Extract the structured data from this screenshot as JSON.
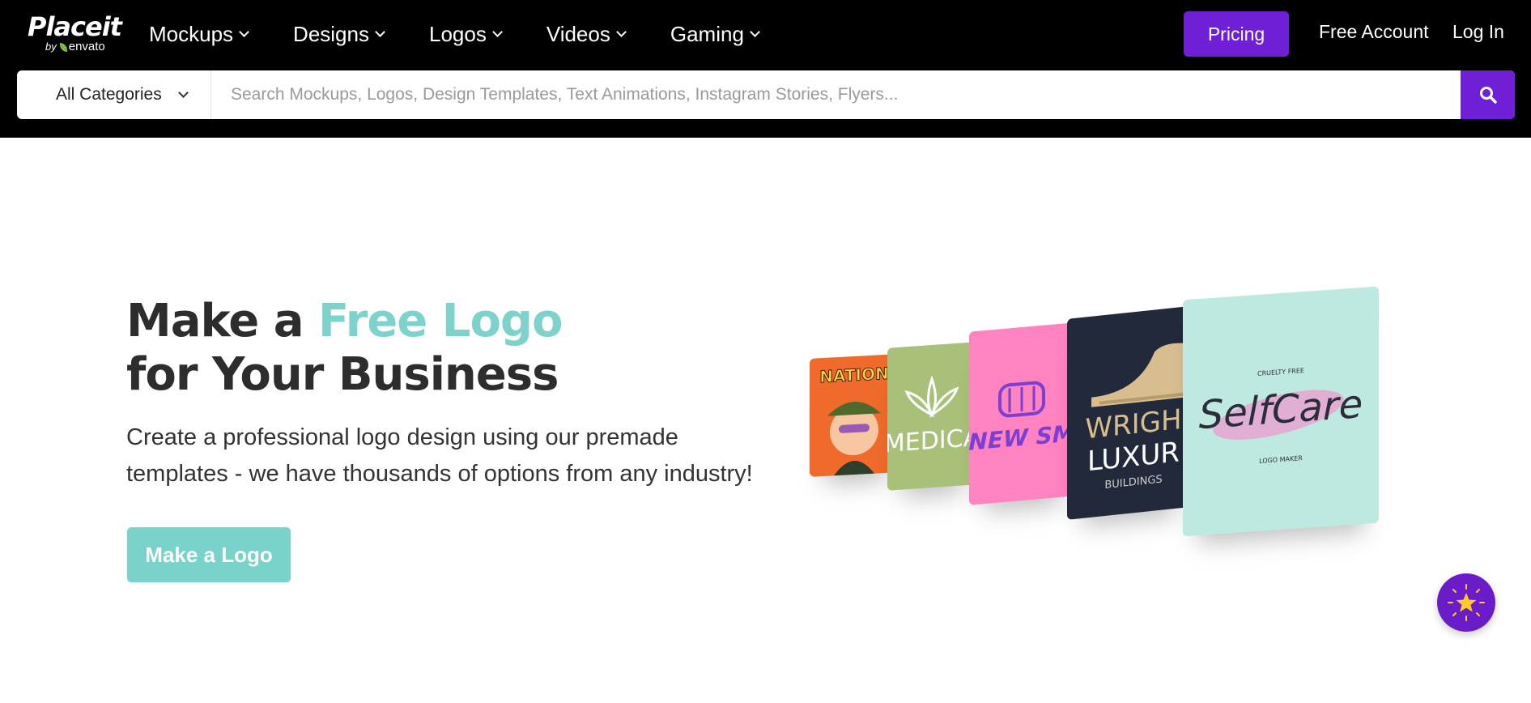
{
  "brand": {
    "name": "Placeit",
    "by": "by",
    "company": "envato"
  },
  "nav": {
    "items": [
      {
        "label": "Mockups"
      },
      {
        "label": "Designs"
      },
      {
        "label": "Logos"
      },
      {
        "label": "Videos"
      },
      {
        "label": "Gaming"
      }
    ],
    "pricing_label": "Pricing",
    "free_account_label": "Free Account",
    "login_label": "Log In"
  },
  "search": {
    "category": "All Categories",
    "placeholder": "Search Mockups, Logos, Design Templates, Text Animations, Instagram Stories, Flyers..."
  },
  "hero": {
    "title_pre": "Make a ",
    "title_accent": "Free Logo",
    "title_line2": "for Your Business",
    "subtitle": "Create a professional logo design using our premade templates - we have thousands of options from any industry!",
    "cta_label": "Make a Logo"
  },
  "cards": {
    "card1_text": "NATION",
    "card2_text": "MEDICA",
    "card3_text": "NEW SM",
    "card4_line1": "WRIGH",
    "card4_line2": "LUXUR",
    "card4_line3": "BUILDINGS",
    "card5_top": "CRUELTY FREE",
    "card5_script": "SelfCare",
    "card5_bottom": "LOGO MAKER"
  },
  "colors": {
    "topbar": "#000000",
    "brand_purple": "#6f1fd6",
    "accent_teal": "#7dd3cb",
    "cta_teal": "#79d3cb"
  },
  "icons": {
    "search": "search-icon",
    "star_badge": "sparkle-star-icon"
  }
}
